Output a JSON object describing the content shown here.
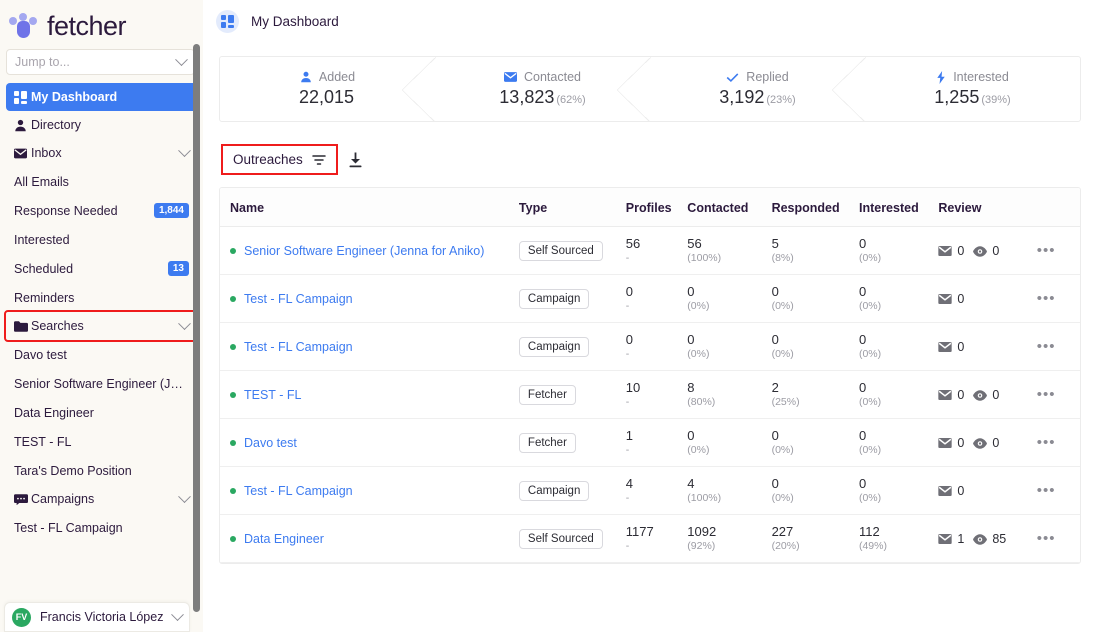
{
  "brand": {
    "name": "fetcher",
    "logo_icon": "fetcher-paw-logo"
  },
  "sidebar": {
    "search": {
      "placeholder": "Jump to...",
      "value": "",
      "chevron_icon": "chevron-down-icon"
    },
    "nav": [
      {
        "label": "My Dashboard",
        "icon": "dashboard-grid-icon",
        "active": true,
        "badge": null,
        "chevron": false
      },
      {
        "label": "Directory",
        "icon": "person-icon",
        "active": false,
        "badge": null,
        "chevron": false
      },
      {
        "label": "Inbox",
        "icon": "envelope-icon",
        "active": false,
        "badge": null,
        "chevron": true
      }
    ],
    "inbox_children": [
      {
        "label": "All Emails",
        "badge": null
      },
      {
        "label": "Response Needed",
        "badge": "1,844"
      },
      {
        "label": "Interested",
        "badge": null
      },
      {
        "label": "Scheduled",
        "badge": "13"
      },
      {
        "label": "Reminders",
        "badge": null
      }
    ],
    "searches_group": {
      "label": "Searches",
      "icon": "folder-icon",
      "chevron_icon": "chevron-down-icon",
      "highlighted": true
    },
    "searches_children": [
      {
        "label": "Davo test"
      },
      {
        "label": "Senior Software Engineer (Jen..."
      },
      {
        "label": "Data Engineer"
      },
      {
        "label": "TEST - FL"
      },
      {
        "label": "Tara's Demo Position"
      }
    ],
    "campaigns_group": {
      "label": "Campaigns",
      "icon": "chat-bubble-icon",
      "chevron_icon": "chevron-down-icon"
    },
    "campaigns_children": [
      {
        "label": "Test - FL Campaign"
      }
    ],
    "profile": {
      "initials": "FV",
      "name": "Francis Victoria López",
      "chevron_icon": "chevron-down-icon"
    }
  },
  "topbar": {
    "title": "My Dashboard",
    "icon": "dashboard-grid-icon"
  },
  "stats": [
    {
      "label": "Added",
      "icon": "person-icon",
      "value": "22,015",
      "pct": ""
    },
    {
      "label": "Contacted",
      "icon": "envelope-icon",
      "value": "13,823",
      "pct": "(62%)"
    },
    {
      "label": "Replied",
      "icon": "check-icon",
      "value": "3,192",
      "pct": "(23%)"
    },
    {
      "label": "Interested",
      "icon": "lightning-icon",
      "value": "1,255",
      "pct": "(39%)"
    }
  ],
  "toolbar": {
    "outreaches_label": "Outreaches",
    "filter_icon": "filter-icon",
    "download_icon": "download-icon",
    "highlighted": true
  },
  "table": {
    "columns": [
      "Name",
      "Type",
      "Profiles",
      "Contacted",
      "Responded",
      "Interested",
      "Review"
    ],
    "rows": [
      {
        "name": "Senior Software Engineer (Jenna for Aniko)",
        "type": "Self Sourced",
        "profiles": "56",
        "profiles_sub": "-",
        "contacted": "56",
        "contacted_pct": "(100%)",
        "responded": "5",
        "responded_pct": "(8%)",
        "interested": "0",
        "interested_pct": "(0%)",
        "review_mail": "0",
        "review_eye": "0",
        "has_eye": true
      },
      {
        "name": "Test - FL Campaign",
        "type": "Campaign",
        "profiles": "0",
        "profiles_sub": "-",
        "contacted": "0",
        "contacted_pct": "(0%)",
        "responded": "0",
        "responded_pct": "(0%)",
        "interested": "0",
        "interested_pct": "(0%)",
        "review_mail": "0",
        "review_eye": "",
        "has_eye": false
      },
      {
        "name": "Test - FL Campaign",
        "type": "Campaign",
        "profiles": "0",
        "profiles_sub": "-",
        "contacted": "0",
        "contacted_pct": "(0%)",
        "responded": "0",
        "responded_pct": "(0%)",
        "interested": "0",
        "interested_pct": "(0%)",
        "review_mail": "0",
        "review_eye": "",
        "has_eye": false
      },
      {
        "name": "TEST - FL",
        "type": "Fetcher",
        "profiles": "10",
        "profiles_sub": "-",
        "contacted": "8",
        "contacted_pct": "(80%)",
        "responded": "2",
        "responded_pct": "(25%)",
        "interested": "0",
        "interested_pct": "(0%)",
        "review_mail": "0",
        "review_eye": "0",
        "has_eye": true
      },
      {
        "name": "Davo test",
        "type": "Fetcher",
        "profiles": "1",
        "profiles_sub": "-",
        "contacted": "0",
        "contacted_pct": "(0%)",
        "responded": "0",
        "responded_pct": "(0%)",
        "interested": "0",
        "interested_pct": "(0%)",
        "review_mail": "0",
        "review_eye": "0",
        "has_eye": true
      },
      {
        "name": "Test - FL Campaign",
        "type": "Campaign",
        "profiles": "4",
        "profiles_sub": "-",
        "contacted": "4",
        "contacted_pct": "(100%)",
        "responded": "0",
        "responded_pct": "(0%)",
        "interested": "0",
        "interested_pct": "(0%)",
        "review_mail": "0",
        "review_eye": "",
        "has_eye": false
      },
      {
        "name": "Data Engineer",
        "type": "Self Sourced",
        "profiles": "1177",
        "profiles_sub": "-",
        "contacted": "1092",
        "contacted_pct": "(92%)",
        "responded": "227",
        "responded_pct": "(20%)",
        "interested": "112",
        "interested_pct": "(49%)",
        "review_mail": "1",
        "review_eye": "85",
        "has_eye": true
      }
    ],
    "more_icon": "ellipsis-icon",
    "mail_icon": "envelope-icon",
    "eye_icon": "eye-icon"
  },
  "colors": {
    "accent_blue": "#3d7bf0",
    "sidebar_bg": "#fbf9f4",
    "highlight_red": "#ef1c1c",
    "status_green": "#2aa861",
    "logo_purple": "#6f73e8"
  }
}
